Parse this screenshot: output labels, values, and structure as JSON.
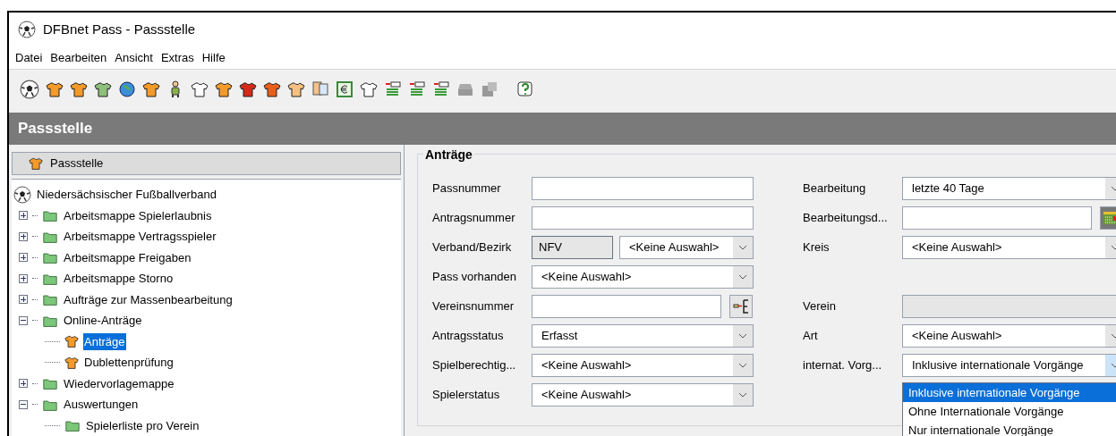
{
  "window": {
    "title": "DFBnet Pass - Passstelle"
  },
  "menu": [
    "Datei",
    "Bearbeiten",
    "Ansicht",
    "Extras",
    "Hilfe"
  ],
  "header": "Passstelle",
  "sidebar": {
    "title": "Passstelle",
    "tree": [
      {
        "label": "Niedersächsischer Fußballverband",
        "kind": "ball",
        "selected": false,
        "children": [
          {
            "label": "Arbeitsmappe Spielerlaubnis",
            "kind": "folder",
            "expanded": false,
            "selected": false
          },
          {
            "label": "Arbeitsmappe Vertragsspieler",
            "kind": "folder",
            "expanded": false,
            "selected": false
          },
          {
            "label": "Arbeitsmappe Freigaben",
            "kind": "folder",
            "expanded": false,
            "selected": false
          },
          {
            "label": "Arbeitsmappe Storno",
            "kind": "folder",
            "expanded": false,
            "selected": false
          },
          {
            "label": "Aufträge zur Massenbearbeitung",
            "kind": "folder",
            "expanded": false,
            "selected": false
          },
          {
            "label": "Online-Anträge",
            "kind": "folder",
            "expanded": true,
            "selected": false,
            "children": [
              {
                "label": "Anträge",
                "kind": "shirt",
                "selected": true
              },
              {
                "label": "Dublettenprüfung",
                "kind": "shirt",
                "selected": false
              }
            ]
          },
          {
            "label": "Wiedervorlagemappe",
            "kind": "folder",
            "expanded": false,
            "selected": false
          },
          {
            "label": "Auswertungen",
            "kind": "folder",
            "expanded": true,
            "selected": false,
            "children": [
              {
                "label": "Spielerliste pro Verein",
                "kind": "folder",
                "selected": false
              }
            ]
          }
        ]
      }
    ]
  },
  "form": {
    "title": "Anträge",
    "left": [
      {
        "label": "Passnummer",
        "kind": "text"
      },
      {
        "label": "Antragsnummer",
        "kind": "text"
      },
      {
        "label": "Verband/Bezirk",
        "kind": "split",
        "value": "NFV",
        "select": "<Keine Auswahl>"
      },
      {
        "label": "Pass vorhanden",
        "kind": "combo",
        "value": "<Keine Auswahl>"
      },
      {
        "label": "Vereinsnummer",
        "kind": "lookup"
      },
      {
        "label": "Antragsstatus",
        "kind": "combo",
        "value": "Erfasst"
      },
      {
        "label": "Spielberechtig...",
        "kind": "combo",
        "value": "<Keine Auswahl>"
      },
      {
        "label": "Spielerstatus",
        "kind": "combo",
        "value": "<Keine Auswahl>"
      }
    ],
    "right": [
      {
        "label": "Bearbeitung",
        "kind": "combo",
        "value": "letzte 40 Tage"
      },
      {
        "label": "Bearbeitungsd...",
        "kind": "date"
      },
      {
        "label": "Kreis",
        "kind": "combo",
        "value": "<Keine Auswahl>"
      },
      {
        "kind": "blank"
      },
      {
        "label": "Verein",
        "kind": "readonly"
      },
      {
        "label": "Art",
        "kind": "combo",
        "value": "<Keine Auswahl>"
      },
      {
        "label": "internat. Vorg...",
        "kind": "combo",
        "value": "Inklusive internationale Vorgänge",
        "open": true,
        "options": [
          {
            "label": "Inklusive internationale Vorgänge",
            "selected": true
          },
          {
            "label": "Ohne Internationale Vorgänge",
            "selected": false
          },
          {
            "label": "Nur internationale Vorgänge",
            "selected": false
          }
        ]
      }
    ]
  }
}
